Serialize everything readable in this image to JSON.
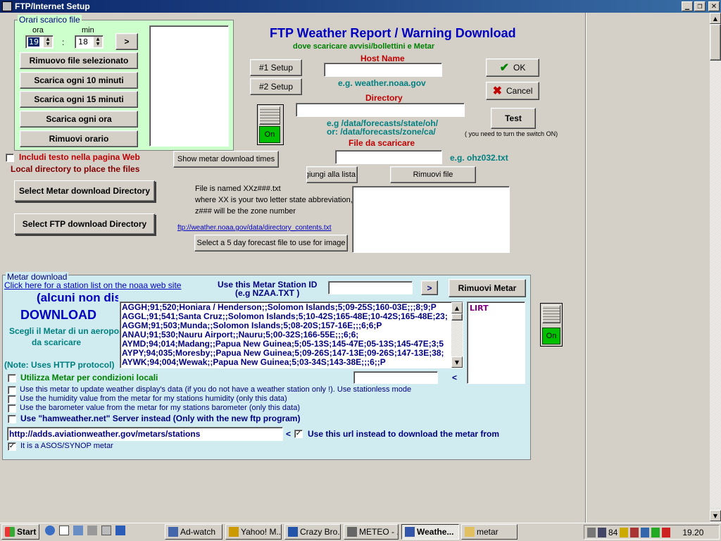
{
  "window": {
    "title": "FTP/Internet Setup",
    "controls": [
      "minimize",
      "maximize",
      "close"
    ],
    "title_bar_color": "#0a246a"
  },
  "schedule": {
    "legend": "Orari scarico file",
    "hour_label": "ora",
    "minute_label": "min",
    "hour_value": "19",
    "separator": ":",
    "minute_value": "18",
    "add_button": ">",
    "buttons": [
      "Rimuovo file selezionato",
      "Scarica ogni 10 minuti",
      "Scarica ogni 15 minuti",
      "Scarica ogni ora",
      "Rimuovi orario"
    ]
  },
  "header": {
    "title": "FTP Weather Report / Warning Download",
    "subtitle": "dove scaricare avvisi/bollettini e Metar"
  },
  "ftp": {
    "setup1": "#1 Setup",
    "setup2": "#2 Setup",
    "host_label": "Host Name",
    "host_value": "",
    "host_example": "e.g. weather.noaa.gov",
    "dir_label": "Directory",
    "dir_value": "",
    "dir_example1": "e.g /data/forecasts/state/oh/",
    "dir_example2": "or: /data/forecasts/zone/ca/",
    "file_label": "File da scaricare",
    "file_value": "",
    "file_example": "e.g. ohz032.txt",
    "add_list": "Aggiungi alla lista",
    "remove_file": "Rimuovi file",
    "switch_label": "On",
    "ok": "OK",
    "cancel": "Cancel",
    "test": "Test",
    "test_note": "( you need to turn the switch ON)"
  },
  "left_opts": {
    "include_text": "Includi testo nella pagina Web",
    "local_dir": "Local directory to place the files",
    "show_metar_times": "Show metar download times",
    "select_metar_dir": "Select Metar download Directory",
    "select_ftp_dir": "Select FTP download  Directory"
  },
  "file_info": {
    "line1": "File is named XXz###.txt",
    "line2": "where XX is your two letter state abbreviation,",
    "line3": "z### will be the zone number",
    "link": "ftp://weather.noaa.gov/data/directory_contents.txt",
    "select_5day": "Select a 5 day forecast file to use for image"
  },
  "metar": {
    "legend": "Metar download",
    "station_link": "Click here for a station list on the noaa web site",
    "unavailable": "(alcuni non disponibili)",
    "download": "DOWNLOAD",
    "choose1": "Scegli il Metar di un aeroporto",
    "choose2": "da scaricare",
    "http_note": "(Note: Uses HTTP protocol)",
    "station_id_label1": "Use this Metar Station ID",
    "station_id_label2": "(e.g NZAA.TXT )",
    "station_id_value": "",
    "go_btn": ">",
    "remove_btn": "Rimuovi Metar",
    "stations": [
      "AGGH;91;520;Honiara / Henderson;;Solomon Islands;5;09-25S;160-03E;;;8;9;P",
      "AGGL;91;541;Santa Cruz;;Solomon Islands;5;10-42S;165-48E;10-42S;165-48E;23;",
      "AGGM;91;503;Munda;;Solomon Islands;5;08-20S;157-16E;;;6;6;P",
      "ANAU;91;530;Nauru Airport;;Nauru;5;00-32S;166-55E;;;6;6;",
      "AYMD;94;014;Madang;;Papua New Guinea;5;05-13S;145-47E;05-13S;145-47E;3;5",
      "AYPY;94;035;Moresby;;Papua New Guinea;5;09-26S;147-13E;09-26S;147-13E;38;",
      "AYWK;94;004;Wewak;;Papua New Guinea;5;03-34S;143-38E;;;6;;P"
    ],
    "selected_station": "LIRT",
    "search_value": "",
    "search_arrow": "<",
    "switch_label": "On",
    "opt_local": "Utilizza Metar per condizioni locali",
    "opt_stationless": "Use this metar to update weather display's data (if you do not have a weather station only !). Use stationless mode",
    "opt_humidity": "Use the humidity value from the metar for my stations humidity (only this data)",
    "opt_barometer": "Use the barometer value from the metar for my stations barometer (only this data)",
    "opt_hamweather": "Use \"hamweather.net\" Server instead (Only with the new ftp program)",
    "url_value": "http://adds.aviationweather.gov/metars/stations",
    "url_arrow": "<",
    "use_url": "Use this url instead to download the metar from",
    "use_url_checked": true,
    "asos": "It is a ASOS/SYNOP metar",
    "asos_checked": true
  },
  "taskbar": {
    "start": "Start",
    "items": [
      "Ad-watch",
      "Yahoo! M...",
      "Crazy Bro...",
      "METEO - ...",
      "Weathe...",
      "metar"
    ],
    "active_index": 4,
    "tray_number": "84",
    "clock": "19.20"
  }
}
